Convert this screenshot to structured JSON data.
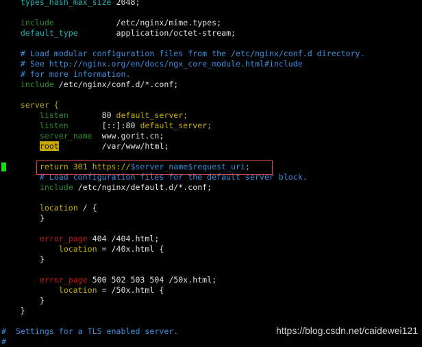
{
  "lines": [
    [
      [
        "    ",
        "t"
      ],
      [
        "types_hash_max_size",
        "cy"
      ],
      [
        " 2048;",
        "t"
      ]
    ],
    [],
    [
      [
        "    ",
        "t"
      ],
      [
        "include",
        "gr"
      ],
      [
        "             /etc/nginx/mime.types;",
        "t"
      ]
    ],
    [
      [
        "    ",
        "t"
      ],
      [
        "default_type",
        "cy"
      ],
      [
        "        application/octet-stream;",
        "t"
      ]
    ],
    [],
    [
      [
        "    ",
        "t"
      ],
      [
        "# Load modular configuration files from the /etc/nginx/conf.d directory.",
        "cm"
      ]
    ],
    [
      [
        "    ",
        "t"
      ],
      [
        "# See http://nginx.org/en/docs/ngx_core_module.html#include",
        "cm"
      ]
    ],
    [
      [
        "    ",
        "t"
      ],
      [
        "# for more information.",
        "cm"
      ]
    ],
    [
      [
        "    ",
        "t"
      ],
      [
        "include",
        "gr"
      ],
      [
        " /etc/nginx/conf.d/*.conf;",
        "t"
      ]
    ],
    [],
    [
      [
        "    ",
        "t"
      ],
      [
        "server {",
        "ol"
      ]
    ],
    [
      [
        "        ",
        "t"
      ],
      [
        "listen",
        "gr"
      ],
      [
        "       80 ",
        "t"
      ],
      [
        "default_server;",
        "yl"
      ]
    ],
    [
      [
        "        ",
        "t"
      ],
      [
        "listen",
        "gr"
      ],
      [
        "       [::]:80 ",
        "t"
      ],
      [
        "default_server;",
        "yl"
      ]
    ],
    [
      [
        "        ",
        "t"
      ],
      [
        "server_name",
        "gr"
      ],
      [
        "  www.gorit.cn;",
        "t"
      ]
    ],
    [
      [
        "        ",
        "t"
      ],
      [
        "root",
        "hl"
      ],
      [
        "         /var/www/html;",
        "t"
      ]
    ],
    [],
    [
      [
        "        ",
        "t"
      ],
      [
        "return 301 https://",
        "yl"
      ],
      [
        "$server_name$request_uri",
        "cm"
      ],
      [
        ";",
        "yl"
      ]
    ],
    [
      [
        "        ",
        "t"
      ],
      [
        "# Load configuration files for the default server block.",
        "cm"
      ]
    ],
    [
      [
        "        ",
        "t"
      ],
      [
        "include",
        "gr"
      ],
      [
        " /etc/nginx/default.d/*.conf;",
        "t"
      ]
    ],
    [],
    [
      [
        "        ",
        "t"
      ],
      [
        "location",
        "yl"
      ],
      [
        " / {",
        "t"
      ]
    ],
    [
      [
        "        }",
        "t"
      ]
    ],
    [],
    [
      [
        "        ",
        "t"
      ],
      [
        "error_page",
        "rd"
      ],
      [
        " 404 /404.html;",
        "t"
      ]
    ],
    [
      [
        "            ",
        "t"
      ],
      [
        "location",
        "yl"
      ],
      [
        " = /40x.html {",
        "t"
      ]
    ],
    [
      [
        "        }",
        "t"
      ]
    ],
    [],
    [
      [
        "        ",
        "t"
      ],
      [
        "error_page",
        "rd"
      ],
      [
        " 500 502 503 504 /50x.html;",
        "t"
      ]
    ],
    [
      [
        "            ",
        "t"
      ],
      [
        "location",
        "yl"
      ],
      [
        " = /50x.html {",
        "t"
      ]
    ],
    [
      [
        "        }",
        "t"
      ]
    ],
    [
      [
        "    }",
        "t"
      ]
    ],
    [],
    [
      [
        "#",
        "cm"
      ],
      [
        "  Settings for a TLS enabled server.",
        "cm"
      ]
    ],
    [
      [
        "#",
        "cm"
      ]
    ]
  ],
  "watermark": "https://blog.csdn.net/caidewei121"
}
